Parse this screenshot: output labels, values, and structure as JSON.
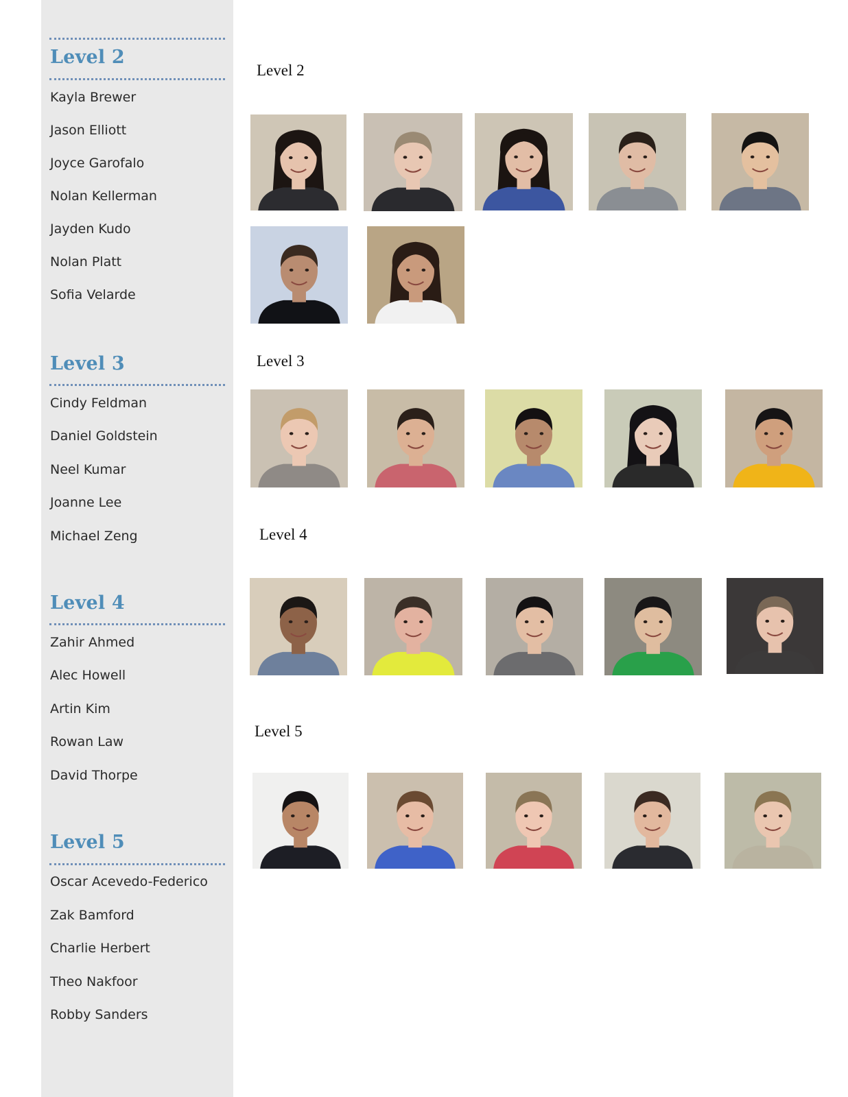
{
  "sidebar": {
    "sections": [
      {
        "heading": "Level 2",
        "names": [
          "Kayla Brewer",
          "Jason Elliott",
          "Joyce Garofalo",
          "Nolan Kellerman",
          "Jayden Kudo",
          "Nolan Platt",
          "Sofia Velarde"
        ]
      },
      {
        "heading": "Level 3",
        "names": [
          "Cindy Feldman",
          "Daniel Goldstein",
          "Neel Kumar",
          "Joanne Lee",
          "Michael Zeng"
        ]
      },
      {
        "heading": "Level 4",
        "names": [
          "Zahir Ahmed",
          "Alec Howell",
          "Artin Kim",
          "Rowan Law",
          "David Thorpe"
        ]
      },
      {
        "heading": "Level 5",
        "names": [
          "Oscar Acevedo-Federico",
          "Zak Bamford",
          "Charlie Herbert",
          "Theo Nakfoor",
          "Robby Sanders"
        ]
      }
    ]
  },
  "main": {
    "headings": [
      "Level 2",
      "Level 3",
      "Level 4",
      "Level 5"
    ],
    "photos": [
      {
        "bg": "#cfc6b6",
        "hair": "#1c1512",
        "shirt": "#2c2c30",
        "skin": "#e6c3ad",
        "long": true
      },
      {
        "bg": "#c9c0b4",
        "hair": "#9a8a74",
        "shirt": "#2a2a2e",
        "skin": "#e8c7b3",
        "long": false
      },
      {
        "bg": "#cdc5b5",
        "hair": "#1b1411",
        "shirt": "#3c56a0",
        "skin": "#e2bda6",
        "long": true
      },
      {
        "bg": "#c8c3b4",
        "hair": "#2a2019",
        "shirt": "#8a8e93",
        "skin": "#e0bca5",
        "long": false
      },
      {
        "bg": "#c6b9a5",
        "hair": "#141312",
        "shirt": "#6d7585",
        "skin": "#e4c09f",
        "long": false
      },
      {
        "bg": "#c9d3e3",
        "hair": "#3a2a20",
        "shirt": "#111216",
        "skin": "#b98c71",
        "long": false
      },
      {
        "bg": "#b9a585",
        "hair": "#2a1c15",
        "shirt": "#f1f1f1",
        "skin": "#c99a7c",
        "long": true
      },
      {
        "bg": "#cac1b3",
        "hair": "#c29c6a",
        "shirt": "#8f8a86",
        "skin": "#ecc8b3",
        "long": false
      },
      {
        "bg": "#c8bca7",
        "hair": "#2b201a",
        "shirt": "#c9646e",
        "skin": "#dcb093",
        "long": false
      },
      {
        "bg": "#dcdca6",
        "hair": "#141112",
        "shirt": "#6a87c2",
        "skin": "#b78a6c",
        "long": false
      },
      {
        "bg": "#c9cbb8",
        "hair": "#141215",
        "shirt": "#2a2a2a",
        "skin": "#e9cbb9",
        "long": true
      },
      {
        "bg": "#c4b6a2",
        "hair": "#161415",
        "shirt": "#f0b418",
        "skin": "#cf9f7d",
        "long": false
      },
      {
        "bg": "#d8cdbb",
        "hair": "#1b1715",
        "shirt": "#6e809c",
        "skin": "#8d6248",
        "long": false
      },
      {
        "bg": "#bdb4a7",
        "hair": "#3a2f27",
        "shirt": "#e3ea3c",
        "skin": "#e3b2a0",
        "long": false
      },
      {
        "bg": "#b4aea4",
        "hair": "#141213",
        "shirt": "#6c6c6e",
        "skin": "#e3bea4",
        "long": false
      },
      {
        "bg": "#8d8a80",
        "hair": "#191718",
        "shirt": "#29a04a",
        "skin": "#dfbd9f",
        "long": false
      },
      {
        "bg": "#3b3838",
        "hair": "#7a6856",
        "shirt": "#3c3a3a",
        "skin": "#e7c2ad",
        "long": false
      },
      {
        "bg": "#f0f0ef",
        "hair": "#161314",
        "shirt": "#1d1e25",
        "skin": "#b88666",
        "long": false
      },
      {
        "bg": "#cbbfae",
        "hair": "#6a4a32",
        "shirt": "#3f62c8",
        "skin": "#e7bca5",
        "long": false
      },
      {
        "bg": "#c4bba9",
        "hair": "#8a7556",
        "shirt": "#d04454",
        "skin": "#efc7b3",
        "long": false
      },
      {
        "bg": "#dad8ce",
        "hair": "#3b2a22",
        "shirt": "#2a2b30",
        "skin": "#e2b89e",
        "long": false
      },
      {
        "bg": "#bdbba8",
        "hair": "#8a7552",
        "shirt": "#b9b3a0",
        "skin": "#eac6b0",
        "long": false
      }
    ]
  }
}
